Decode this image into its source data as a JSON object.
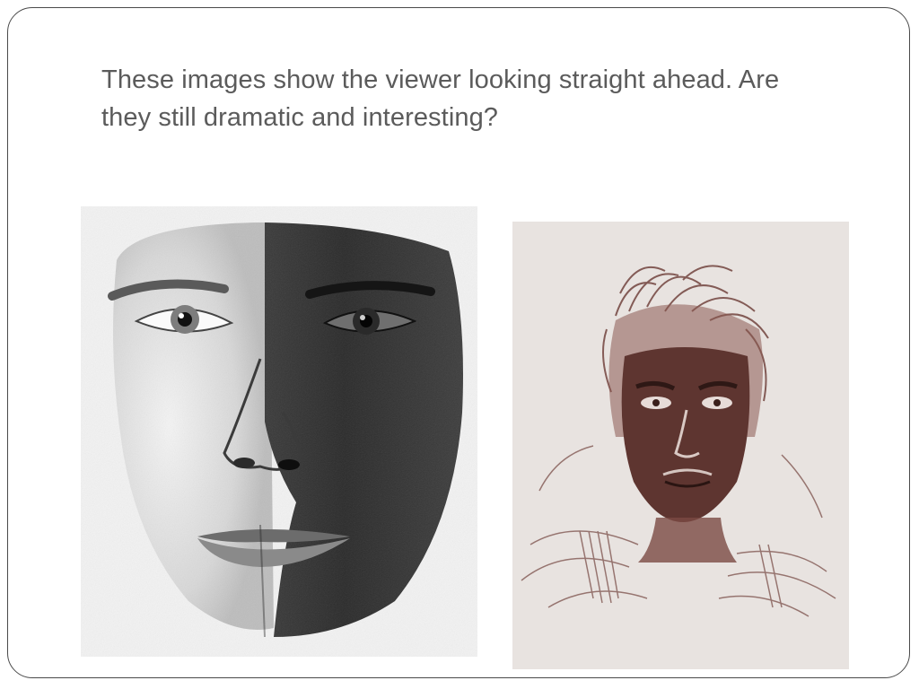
{
  "slide": {
    "title_line1": "These images show the viewer looking straight ahead.  Are",
    "title_line2": "they still dramatic and interesting?"
  },
  "images": [
    {
      "subject": "charcoal drawing of a face, half in shadow, eyes looking straight ahead",
      "palette": "grayscale"
    },
    {
      "subject": "sepia pencil sketch of a man with dramatic lighting and windswept hair",
      "palette": "sepia"
    }
  ],
  "colors": {
    "title_text": "#5b5b5b",
    "frame_border": "#4a4a4a",
    "sepia_ink": "#6b3a34",
    "charcoal_dark": "#262626"
  }
}
